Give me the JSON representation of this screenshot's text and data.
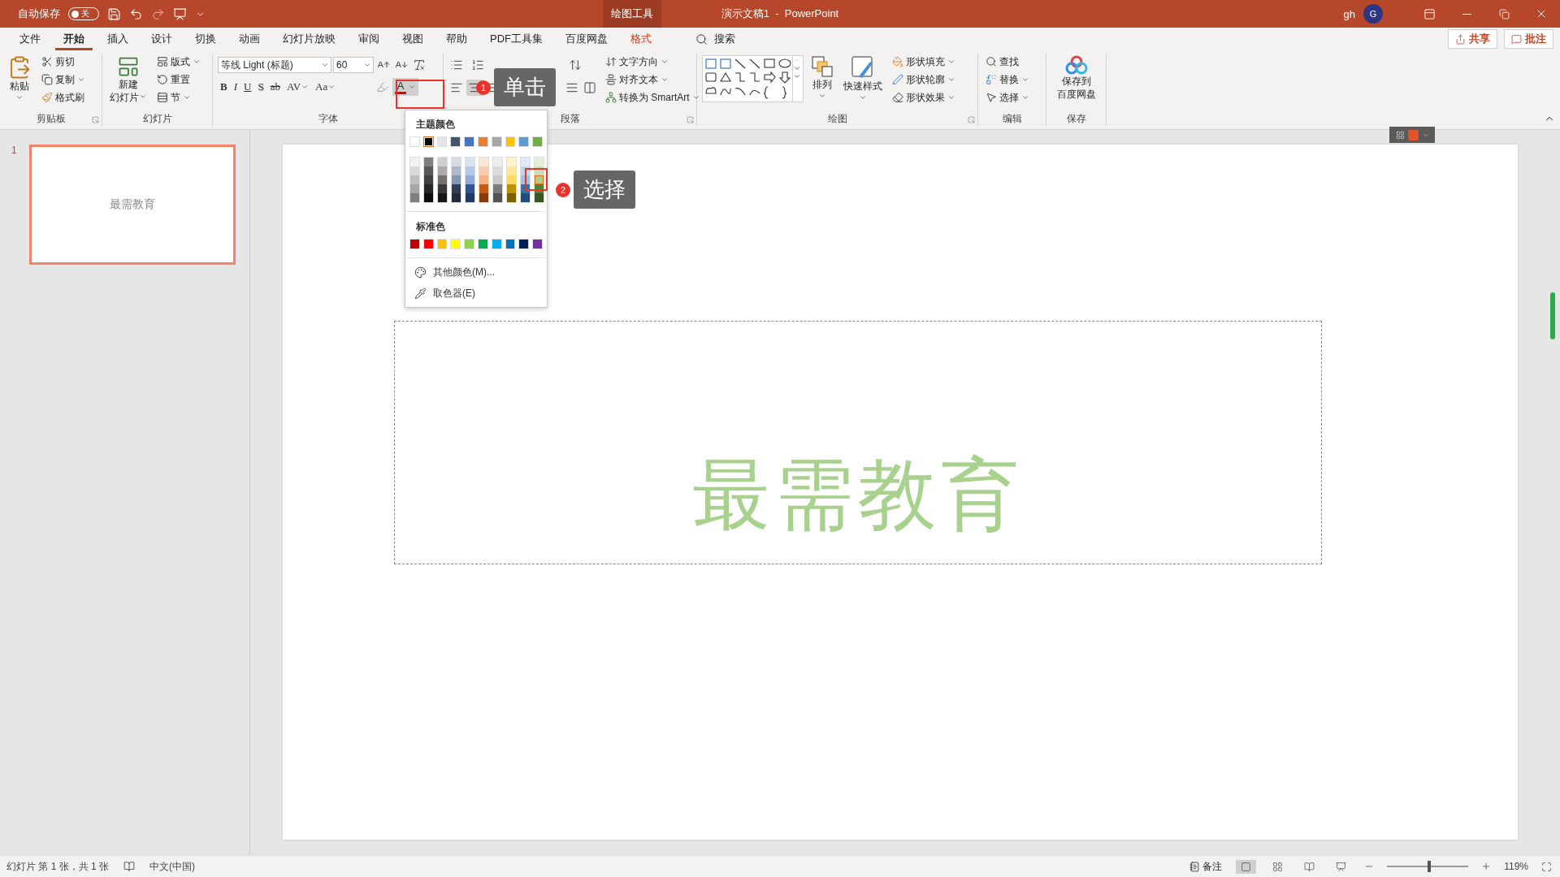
{
  "title_bar": {
    "autosave_label": "自动保存",
    "autosave_state": "关",
    "autosave_on": false,
    "context_tab": "绘图工具",
    "document_title": "演示文稿1  -  PowerPoint",
    "user_name": "gh",
    "avatar_initial": "G"
  },
  "tabs": [
    {
      "label": "文件",
      "selected": false,
      "kind": "normal"
    },
    {
      "label": "开始",
      "selected": true,
      "kind": "normal"
    },
    {
      "label": "插入",
      "selected": false,
      "kind": "normal"
    },
    {
      "label": "设计",
      "selected": false,
      "kind": "normal"
    },
    {
      "label": "切换",
      "selected": false,
      "kind": "normal"
    },
    {
      "label": "动画",
      "selected": false,
      "kind": "normal"
    },
    {
      "label": "幻灯片放映",
      "selected": false,
      "kind": "normal"
    },
    {
      "label": "审阅",
      "selected": false,
      "kind": "normal"
    },
    {
      "label": "视图",
      "selected": false,
      "kind": "normal"
    },
    {
      "label": "帮助",
      "selected": false,
      "kind": "normal"
    },
    {
      "label": "PDF工具集",
      "selected": false,
      "kind": "normal"
    },
    {
      "label": "百度网盘",
      "selected": false,
      "kind": "normal"
    },
    {
      "label": "格式",
      "selected": false,
      "kind": "contextual"
    }
  ],
  "search_label": "搜索",
  "share_button": "共享",
  "comments_button": "批注",
  "clipboard": {
    "label": "剪贴板",
    "paste": "粘贴",
    "cut": "剪切",
    "copy": "复制",
    "format_painter": "格式刷"
  },
  "slides_group": {
    "label": "幻灯片",
    "new_slide": [
      "新建",
      "幻灯片"
    ],
    "layout": "版式",
    "reset": "重置",
    "section": "节"
  },
  "font": {
    "label": "字体",
    "font_name": "等线 Light (标题)",
    "font_size": "60",
    "format_buttons": [
      {
        "text": "B",
        "kind": "bold"
      },
      {
        "text": "I",
        "kind": "italic"
      },
      {
        "text": "U",
        "kind": "underline"
      },
      {
        "text": "S",
        "kind": "shadow"
      },
      {
        "text": "ab",
        "kind": "strike"
      },
      {
        "text": "AV",
        "kind": "spacing"
      },
      {
        "text": "Aa",
        "kind": "case"
      }
    ],
    "font_color_letter": "A"
  },
  "paragraph": {
    "label": "段落",
    "text_direction": "文字方向",
    "align_text": "对齐文本",
    "convert_smartart": "转换为 SmartArt"
  },
  "drawing": {
    "label": "绘图",
    "arrange": "排列",
    "quick_styles": "快速样式",
    "shape_fill": "形状填充",
    "shape_outline": "形状轮廓",
    "shape_effects": "形状效果"
  },
  "editing": {
    "label": "编辑",
    "find": "查找",
    "replace": "替换",
    "select": "选择"
  },
  "save_group": {
    "label": "保存",
    "button": [
      "保存到",
      "百度网盘"
    ]
  },
  "thumbnails": [
    {
      "number": "1",
      "text": "最需教育",
      "selected": true
    }
  ],
  "slide": {
    "text": "最需教育"
  },
  "color_menu": {
    "theme_heading": "主题颜色",
    "theme_colors": [
      {
        "color": "#ffffff",
        "selected": false
      },
      {
        "color": "#000000",
        "selected": true
      },
      {
        "color": "#e7e6e6",
        "selected": false
      },
      {
        "color": "#44546a",
        "selected": false
      },
      {
        "color": "#4472c4",
        "selected": false
      },
      {
        "color": "#ed7d31",
        "selected": false
      },
      {
        "color": "#a5a5a5",
        "selected": false
      },
      {
        "color": "#ffc000",
        "selected": false
      },
      {
        "color": "#5b9bd5",
        "selected": false
      },
      {
        "color": "#70ad47",
        "selected": false
      }
    ],
    "shades": [
      [
        {
          "color": "#f2f2f2",
          "selected": false
        },
        {
          "color": "#d9d9d9",
          "selected": false
        },
        {
          "color": "#bfbfbf",
          "selected": false
        },
        {
          "color": "#a6a6a6",
          "selected": false
        },
        {
          "color": "#808080",
          "selected": false
        }
      ],
      [
        {
          "color": "#7f7f7f",
          "selected": false
        },
        {
          "color": "#595959",
          "selected": false
        },
        {
          "color": "#404040",
          "selected": false
        },
        {
          "color": "#262626",
          "selected": false
        },
        {
          "color": "#0d0d0d",
          "selected": false
        }
      ],
      [
        {
          "color": "#d0cece",
          "selected": false
        },
        {
          "color": "#aeaaaa",
          "selected": false
        },
        {
          "color": "#757171",
          "selected": false
        },
        {
          "color": "#3b3838",
          "selected": false
        },
        {
          "color": "#171616",
          "selected": false
        }
      ],
      [
        {
          "color": "#d6dce5",
          "selected": false
        },
        {
          "color": "#adb9ca",
          "selected": false
        },
        {
          "color": "#8497b0",
          "selected": false
        },
        {
          "color": "#333f50",
          "selected": false
        },
        {
          "color": "#222a35",
          "selected": false
        }
      ],
      [
        {
          "color": "#dae3f3",
          "selected": false
        },
        {
          "color": "#b4c7e7",
          "selected": false
        },
        {
          "color": "#8faadc",
          "selected": false
        },
        {
          "color": "#2f5597",
          "selected": false
        },
        {
          "color": "#203864",
          "selected": false
        }
      ],
      [
        {
          "color": "#fbe5d6",
          "selected": false
        },
        {
          "color": "#f8cbad",
          "selected": false
        },
        {
          "color": "#f4b183",
          "selected": false
        },
        {
          "color": "#c55a11",
          "selected": false
        },
        {
          "color": "#843c0c",
          "selected": false
        }
      ],
      [
        {
          "color": "#ededed",
          "selected": false
        },
        {
          "color": "#dbdbdb",
          "selected": false
        },
        {
          "color": "#c9c9c9",
          "selected": false
        },
        {
          "color": "#7b7b7b",
          "selected": false
        },
        {
          "color": "#525252",
          "selected": false
        }
      ],
      [
        {
          "color": "#fff2cc",
          "selected": false
        },
        {
          "color": "#ffe699",
          "selected": false
        },
        {
          "color": "#ffd966",
          "selected": false
        },
        {
          "color": "#bf9000",
          "selected": false
        },
        {
          "color": "#7f6000",
          "selected": false
        }
      ],
      [
        {
          "color": "#deebf7",
          "selected": false
        },
        {
          "color": "#bdd7ee",
          "selected": false
        },
        {
          "color": "#9dc3e6",
          "selected": false
        },
        {
          "color": "#2e75b6",
          "selected": false
        },
        {
          "color": "#1f4e79",
          "selected": false
        }
      ],
      [
        {
          "color": "#e2f0d9",
          "selected": false
        },
        {
          "color": "#c5e0b4",
          "selected": false
        },
        {
          "color": "#a9d18e",
          "selected": true
        },
        {
          "color": "#548235",
          "selected": false
        },
        {
          "color": "#385723",
          "selected": false
        }
      ]
    ],
    "standard_heading": "标准色",
    "standard_colors": [
      {
        "color": "#c00000",
        "selected": false
      },
      {
        "color": "#ff0000",
        "selected": false
      },
      {
        "color": "#ffc000",
        "selected": false
      },
      {
        "color": "#ffff00",
        "selected": false
      },
      {
        "color": "#92d050",
        "selected": false
      },
      {
        "color": "#00b050",
        "selected": false
      },
      {
        "color": "#00b0f0",
        "selected": false
      },
      {
        "color": "#0070c0",
        "selected": false
      },
      {
        "color": "#002060",
        "selected": false
      },
      {
        "color": "#7030a0",
        "selected": false
      }
    ],
    "more_colors": "其他颜色(M)...",
    "eyedropper": "取色器(E)"
  },
  "callouts": [
    {
      "number": "1",
      "text": "单击"
    },
    {
      "number": "2",
      "text": "选择"
    }
  ],
  "status_bar": {
    "slide_info": "幻灯片 第 1 张，共 1 张",
    "language": "中文(中国)",
    "notes": "备注",
    "zoom": "119%",
    "zoom_slider": {
      "level": 0.52
    }
  }
}
